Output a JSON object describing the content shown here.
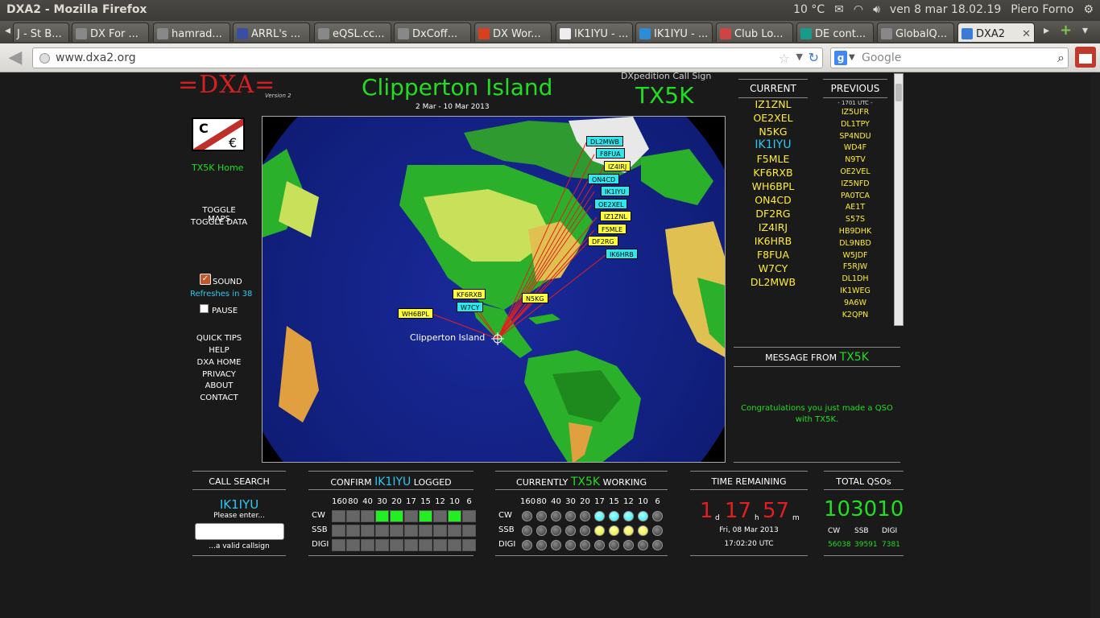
{
  "window": {
    "title": "DXA2 - Mozilla Firefox"
  },
  "tray": {
    "weather": "10 °C",
    "datetime": "ven  8 mar 18.02.19",
    "user": "Piero Forno"
  },
  "tabs": [
    {
      "label": "J - St B..."
    },
    {
      "label": "DX For ..."
    },
    {
      "label": "hamrad..."
    },
    {
      "label": "ARRL's ..."
    },
    {
      "label": "eQSL.cc..."
    },
    {
      "label": "DxCoff..."
    },
    {
      "label": "DX Wor..."
    },
    {
      "label": "IK1IYU - ..."
    },
    {
      "label": "IK1IYU - ..."
    },
    {
      "label": "Club Lo..."
    },
    {
      "label": "DE cont..."
    },
    {
      "label": "GlobalQ..."
    },
    {
      "label": "DXA2"
    }
  ],
  "nav": {
    "url": "www.dxa2.org",
    "search_placeholder": "Google",
    "search_engine": "g"
  },
  "header": {
    "logo": "=DXA=",
    "version": "Version 2",
    "island": "Clipperton Island",
    "dates": "2 Mar  -  10 Mar 2013",
    "dx_label": "DXpedition Call Sign",
    "dx_call": "TX5K"
  },
  "sidebar": {
    "home": "TX5K Home",
    "toggle_maps": "TOGGLE MAPS",
    "toggle_data": "TOGGLE DATA",
    "sound": "SOUND",
    "refreshes": "Refreshes in 38",
    "pause": "PAUSE",
    "links": [
      "QUICK TIPS",
      "HELP",
      "DXA HOME",
      "PRIVACY",
      "ABOUT",
      "CONTACT"
    ]
  },
  "map": {
    "location_label": "Clipperton Island",
    "spots": [
      {
        "call": "DL2MWB",
        "color": "cyan"
      },
      {
        "call": "F8FUA",
        "color": "cyan"
      },
      {
        "call": "IZ4IRJ",
        "color": "yellow"
      },
      {
        "call": "ON4CD",
        "color": "cyan"
      },
      {
        "call": "IK1IYU",
        "color": "cyan"
      },
      {
        "call": "OE2XEL",
        "color": "cyan"
      },
      {
        "call": "IZ1ZNL",
        "color": "yellow"
      },
      {
        "call": "F5MLE",
        "color": "yellow"
      },
      {
        "call": "DF2RG",
        "color": "yellow"
      },
      {
        "call": "IK6HRB",
        "color": "cyan"
      },
      {
        "call": "KF6RXB",
        "color": "yellow"
      },
      {
        "call": "W7CY",
        "color": "cyan"
      },
      {
        "call": "N5KG",
        "color": "yellow"
      },
      {
        "call": "WH6BPL",
        "color": "yellow"
      }
    ]
  },
  "current": {
    "heading": "CURRENT",
    "items": [
      "IZ1ZNL",
      "OE2XEL",
      "N5KG",
      "IK1IYU",
      "F5MLE",
      "KF6RXB",
      "WH6BPL",
      "ON4CD",
      "DF2RG",
      "IZ4IRJ",
      "IK6HRB",
      "F8FUA",
      "W7CY",
      "DL2MWB"
    ]
  },
  "previous": {
    "heading": "PREVIOUS",
    "first": "- 1701 UTC -",
    "items": [
      "IZ5UFR",
      "DL1TPY",
      "SP4NDU",
      "WD4F",
      "N9TV",
      "OE2VEL",
      "IZ5NFD",
      "PA0TCA",
      "AE1T",
      "S57S",
      "HB9DHK",
      "DL9NBD",
      "W5JDF",
      "F5RJW",
      "DL1DH",
      "IK1WEG",
      "9A6W",
      "K2QPN"
    ]
  },
  "message": {
    "heading": "MESSAGE FROM",
    "from": "TX5K",
    "body": "Congratulations you just made a QSO with TX5K."
  },
  "call_search": {
    "heading": "CALL SEARCH",
    "call": "IK1IYU",
    "please": "Please enter...",
    "valid": "...a valid callsign"
  },
  "confirm": {
    "heading_pre": "CONFIRM",
    "call": "IK1IYU",
    "heading_post": "LOGGED",
    "bands": [
      "160",
      "80",
      "40",
      "30",
      "20",
      "17",
      "15",
      "12",
      "10",
      "6"
    ],
    "modes": [
      "CW",
      "SSB",
      "DIGI"
    ],
    "cw": [
      0,
      0,
      0,
      1,
      1,
      0,
      1,
      0,
      1,
      0
    ],
    "ssb": [
      0,
      0,
      0,
      0,
      0,
      0,
      0,
      0,
      0,
      0
    ],
    "digi": [
      0,
      0,
      0,
      0,
      0,
      0,
      0,
      0,
      0,
      0
    ]
  },
  "working": {
    "heading_pre": "CURRENTLY",
    "call": "TX5K",
    "heading_post": "WORKING",
    "bands": [
      "160",
      "80",
      "40",
      "30",
      "20",
      "17",
      "15",
      "12",
      "10",
      "6"
    ],
    "modes": [
      "CW",
      "SSB",
      "DIGI"
    ],
    "cw": [
      0,
      0,
      0,
      0,
      0,
      1,
      1,
      1,
      1,
      0
    ],
    "ssb": [
      0,
      0,
      0,
      0,
      0,
      2,
      2,
      2,
      2,
      0
    ],
    "digi": [
      0,
      0,
      0,
      0,
      0,
      0,
      0,
      0,
      0,
      0
    ]
  },
  "time_remaining": {
    "heading": "TIME REMAINING",
    "days": "1",
    "d": "d",
    "hours": "17",
    "h": "h",
    "minutes": "57",
    "m": "m",
    "date": "Fri, 08 Mar 2013",
    "utc": "17:02:20 UTC"
  },
  "total": {
    "heading": "TOTAL QSOs",
    "value": "103010",
    "labels": [
      "CW",
      "SSB",
      "DIGI"
    ],
    "values": [
      "56038",
      "39591",
      "7381"
    ]
  }
}
